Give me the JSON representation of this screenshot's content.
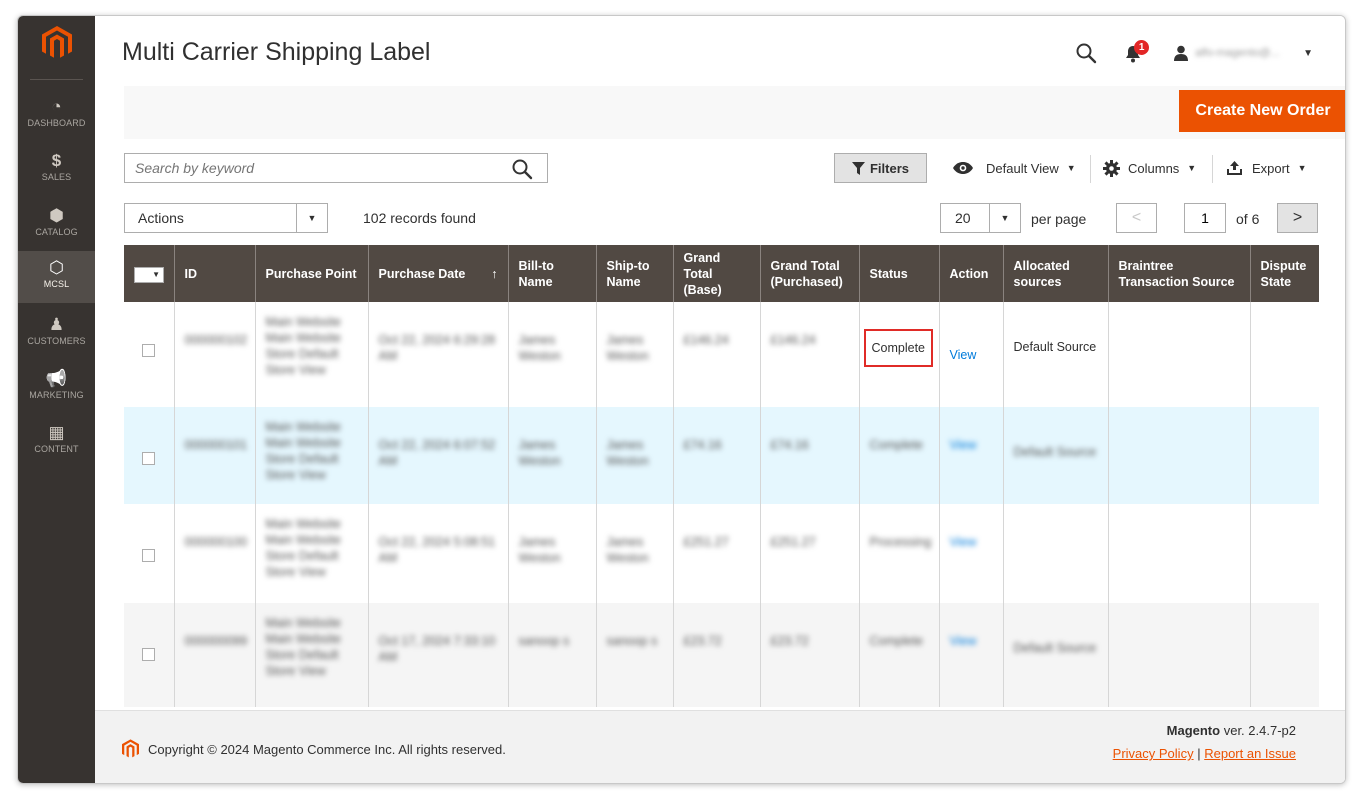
{
  "sidebar": {
    "items": [
      {
        "label": "DASHBOARD",
        "icon": "dashboard-icon"
      },
      {
        "label": "SALES",
        "icon": "dollar-icon"
      },
      {
        "label": "CATALOG",
        "icon": "box-icon"
      },
      {
        "label": "MCSL",
        "icon": "hexagon-icon"
      },
      {
        "label": "CUSTOMERS",
        "icon": "person-icon"
      },
      {
        "label": "MARKETING",
        "icon": "megaphone-icon"
      },
      {
        "label": "CONTENT",
        "icon": "layout-icon"
      }
    ],
    "glyphs": [
      "◔",
      "$",
      "⬢",
      "⬡",
      "♟",
      "📢",
      "▦"
    ],
    "active_index": 3
  },
  "header": {
    "title": "Multi Carrier Shipping Label",
    "notification_count": "1",
    "user_name": "alfo-magento@..."
  },
  "action_bar": {
    "create_label": "Create New Order"
  },
  "toolbar": {
    "search_placeholder": "Search by keyword",
    "filters_label": "Filters",
    "view_label": "Default View",
    "columns_label": "Columns",
    "export_label": "Export",
    "actions_label": "Actions",
    "records_found": "102 records found",
    "per_page_value": "20",
    "per_page_label": "per page",
    "current_page": "1",
    "of_pages": "of 6",
    "prev_glyph": "<",
    "next_glyph": ">"
  },
  "grid": {
    "headers": [
      "ID",
      "Purchase Point",
      "Purchase Date",
      "Bill-to Name",
      "Ship-to Name",
      "Grand Total (Base)",
      "Grand Total (Purchased)",
      "Status",
      "Action",
      "Allocated sources",
      "Braintree Transaction Source",
      "Dispute State"
    ],
    "sort_arrow": "↑",
    "rows": [
      {
        "id": "000000102",
        "purchase_point": "Main Website Main Website Store Default Store View",
        "date": "Oct 22, 2024 6:29:28 AM",
        "bill_to": "James Weston",
        "ship_to": "James Weston",
        "total_base": "£146.24",
        "total_purchased": "£146.24",
        "status": "Complete",
        "action": "View",
        "sources": "Default Source"
      },
      {
        "id": "000000101",
        "purchase_point": "Main Website Main Website Store Default Store View",
        "date": "Oct 22, 2024 6:07:52 AM",
        "bill_to": "James Weston",
        "ship_to": "James Weston",
        "total_base": "£74.16",
        "total_purchased": "£74.16",
        "status": "Complete",
        "action": "View",
        "sources": "Default Source"
      },
      {
        "id": "000000100",
        "purchase_point": "Main Website Main Website Store Default Store View",
        "date": "Oct 22, 2024 5:08:51 AM",
        "bill_to": "James Weston",
        "ship_to": "James Weston",
        "total_base": "£251.27",
        "total_purchased": "£251.27",
        "status": "Processing",
        "action": "View",
        "sources": ""
      },
      {
        "id": "000000099",
        "purchase_point": "Main Website Main Website Store Default Store View",
        "date": "Oct 17, 2024 7:33:10 AM",
        "bill_to": "sanoop s",
        "ship_to": "sanoop s",
        "total_base": "£23.72",
        "total_purchased": "£23.72",
        "status": "Complete",
        "action": "View",
        "sources": "Default Source"
      }
    ]
  },
  "footer": {
    "copyright": "Copyright © 2024 Magento Commerce Inc. All rights reserved.",
    "brand": "Magento",
    "version": "ver. 2.4.7-p2",
    "privacy_label": "Privacy Policy",
    "separator": "|",
    "report_label": "Report an Issue"
  },
  "colors": {
    "brand_orange": "#eb5202",
    "sidebar_bg": "#373330",
    "grid_header_bg": "#514943",
    "highlight_row": "#e5f7fe",
    "status_outline": "#e02b27",
    "link": "#007bdb"
  }
}
